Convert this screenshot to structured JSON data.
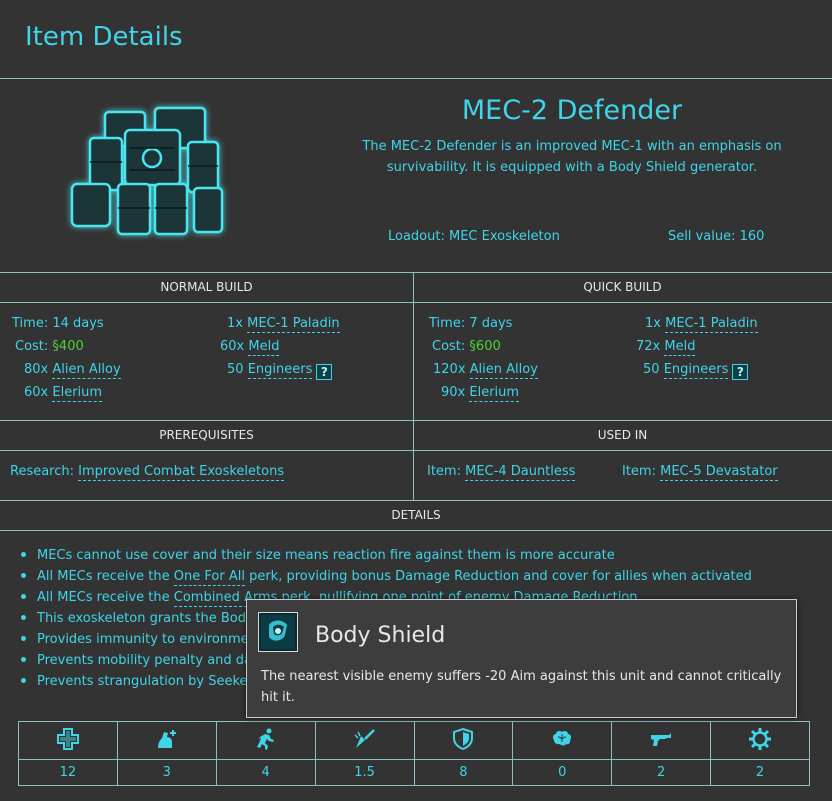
{
  "page": {
    "title": "Item Details"
  },
  "item": {
    "name": "MEC-2 Defender",
    "description": "The MEC-2 Defender is an improved MEC-1 with an emphasis on survivability. It is equipped with a Body Shield generator.",
    "loadout": "Loadout: MEC Exoskeleton",
    "sell_value": "Sell value: 160"
  },
  "normal_build": {
    "header": "NORMAL BUILD",
    "time_label": "Time:",
    "time_value": "14 days",
    "cost_label": "Cost:",
    "cost_value": "§400",
    "resources": [
      {
        "qty": "80x",
        "name": "Alien Alloy"
      },
      {
        "qty": "60x",
        "name": "Elerium"
      }
    ],
    "items": [
      {
        "qty": "1x",
        "name": "MEC-1 Paladin"
      },
      {
        "qty": "60x",
        "name": "Meld"
      },
      {
        "qty": "50",
        "name": "Engineers"
      }
    ]
  },
  "quick_build": {
    "header": "QUICK BUILD",
    "time_label": "Time:",
    "time_value": "7 days",
    "cost_label": "Cost:",
    "cost_value": "§600",
    "resources": [
      {
        "qty": "120x",
        "name": "Alien Alloy"
      },
      {
        "qty": "90x",
        "name": "Elerium"
      }
    ],
    "items": [
      {
        "qty": "1x",
        "name": "MEC-1 Paladin"
      },
      {
        "qty": "72x",
        "name": "Meld"
      },
      {
        "qty": "50",
        "name": "Engineers"
      }
    ]
  },
  "help_button": "?",
  "prerequisites": {
    "header": "PREREQUISITES",
    "label": "Research:",
    "value": "Improved Combat Exoskeletons"
  },
  "used_in": {
    "header": "USED IN",
    "items": [
      {
        "label": "Item:",
        "value": "MEC-4 Dauntless"
      },
      {
        "label": "Item:",
        "value": "MEC-5 Devastator"
      }
    ]
  },
  "details": {
    "header": "DETAILS",
    "lines": [
      {
        "pre": "MECs cannot use cover and their size means reaction fire against them is more accurate",
        "link": "",
        "post": ""
      },
      {
        "pre": "All MECs receive the ",
        "link": "One For All",
        "post": " perk, providing bonus Damage Reduction and cover for allies when activated"
      },
      {
        "pre": "All MECs receive the ",
        "link": "Combined Arms",
        "post": " perk, nullifying one point of enemy Damage Reduction"
      },
      {
        "pre": "This exoskeleton grants the Body ",
        "link": "",
        "post": ""
      },
      {
        "pre": "Provides immunity to environmen",
        "link": "",
        "post": ""
      },
      {
        "pre": "Prevents mobility penalty and dan",
        "link": "",
        "post": ""
      },
      {
        "pre": "Prevents strangulation by Seekers",
        "link": "",
        "post": ""
      }
    ]
  },
  "stats": [
    {
      "icon": "health-icon",
      "value": "12"
    },
    {
      "icon": "strength-icon",
      "value": "3"
    },
    {
      "icon": "mobility-icon",
      "value": "4"
    },
    {
      "icon": "damage-reduction-icon",
      "value": "1.5"
    },
    {
      "icon": "defense-shield-icon",
      "value": "8"
    },
    {
      "icon": "will-brain-icon",
      "value": "0"
    },
    {
      "icon": "aim-gun-icon",
      "value": "2"
    },
    {
      "icon": "tech-gear-icon",
      "value": "2"
    }
  ],
  "tooltip": {
    "icon": "body-shield-icon",
    "title": "Body Shield",
    "text": "The nearest visible enemy suffers -20 Aim against this unit and cannot critically hit it."
  },
  "colors": {
    "accent": "#3fd4e8",
    "background": "#333333",
    "cost": "#4cd137",
    "border": "#8fbfc4"
  }
}
